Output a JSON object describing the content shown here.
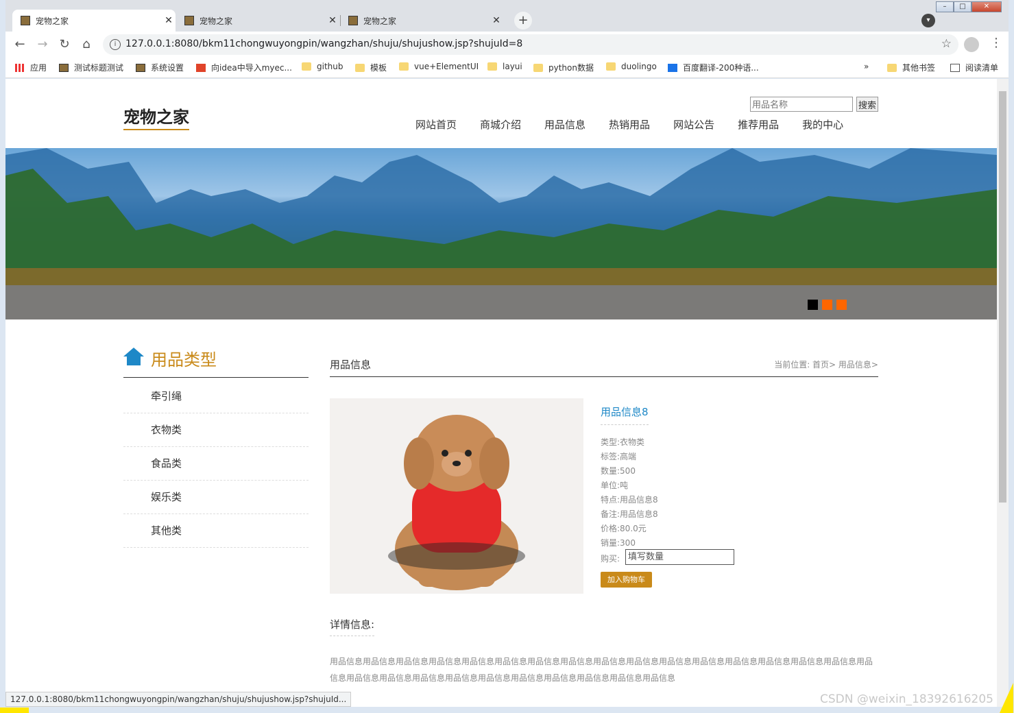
{
  "browser": {
    "tabs": [
      {
        "title": "宠物之家",
        "active": true
      },
      {
        "title": "宠物之家",
        "active": false
      },
      {
        "title": "宠物之家",
        "active": false
      }
    ],
    "url": "127.0.0.1:8080/bkm11chongwuyongpin/wangzhan/shuju/shujushow.jsp?shujuId=8",
    "bookmarks": [
      "应用",
      "测试标题测试",
      "系统设置",
      "向idea中导入myec...",
      "github",
      "模板",
      "vue+ElementUI",
      "layui",
      "python数据",
      "duolingo",
      "百度翻译-200种语...",
      "»",
      "其他书签",
      "阅读清单"
    ],
    "status_url": "127.0.0.1:8080/bkm11chongwuyongpin/wangzhan/shuju/shujushow.jsp?shujuId..."
  },
  "site": {
    "logo": "宠物之家",
    "search_placeholder": "用品名称",
    "search_button": "搜索",
    "nav": [
      "网站首页",
      "商城介绍",
      "用品信息",
      "热销用品",
      "网站公告",
      "推荐用品",
      "我的中心"
    ]
  },
  "banner": {
    "dot_colors": [
      "#000000",
      "#ff6600",
      "#ff6600"
    ]
  },
  "sidebar": {
    "title": "用品类型",
    "categories": [
      "牵引绳",
      "衣物类",
      "食品类",
      "娱乐类",
      "其他类"
    ]
  },
  "content": {
    "section_title": "用品信息",
    "breadcrumb": "当前位置:  首页> 用品信息>",
    "product": {
      "name": "用品信息8",
      "fields": [
        "类型:衣物类",
        "标签:高端",
        "数量:500",
        "单位:吨",
        "特点:用品信息8",
        "备注:用品信息8",
        "价格:80.0元",
        "销量:300"
      ],
      "buy_label": "购买:",
      "qty_placeholder": "填写数量",
      "add_cart": "加入购物车"
    },
    "detail_title": "详情信息:",
    "detail_text": "用品信息用品信息用品信息用品信息用品信息用品信息用品信息用品信息用品信息用品信息用品信息用品信息用品信息用品信息用品信息用品信息用品信息用品信息用品信息用品信息用品信息用品信息用品信息用品信息用品信息用品信息用品信息"
  },
  "watermark": "CSDN @weixin_18392616205"
}
